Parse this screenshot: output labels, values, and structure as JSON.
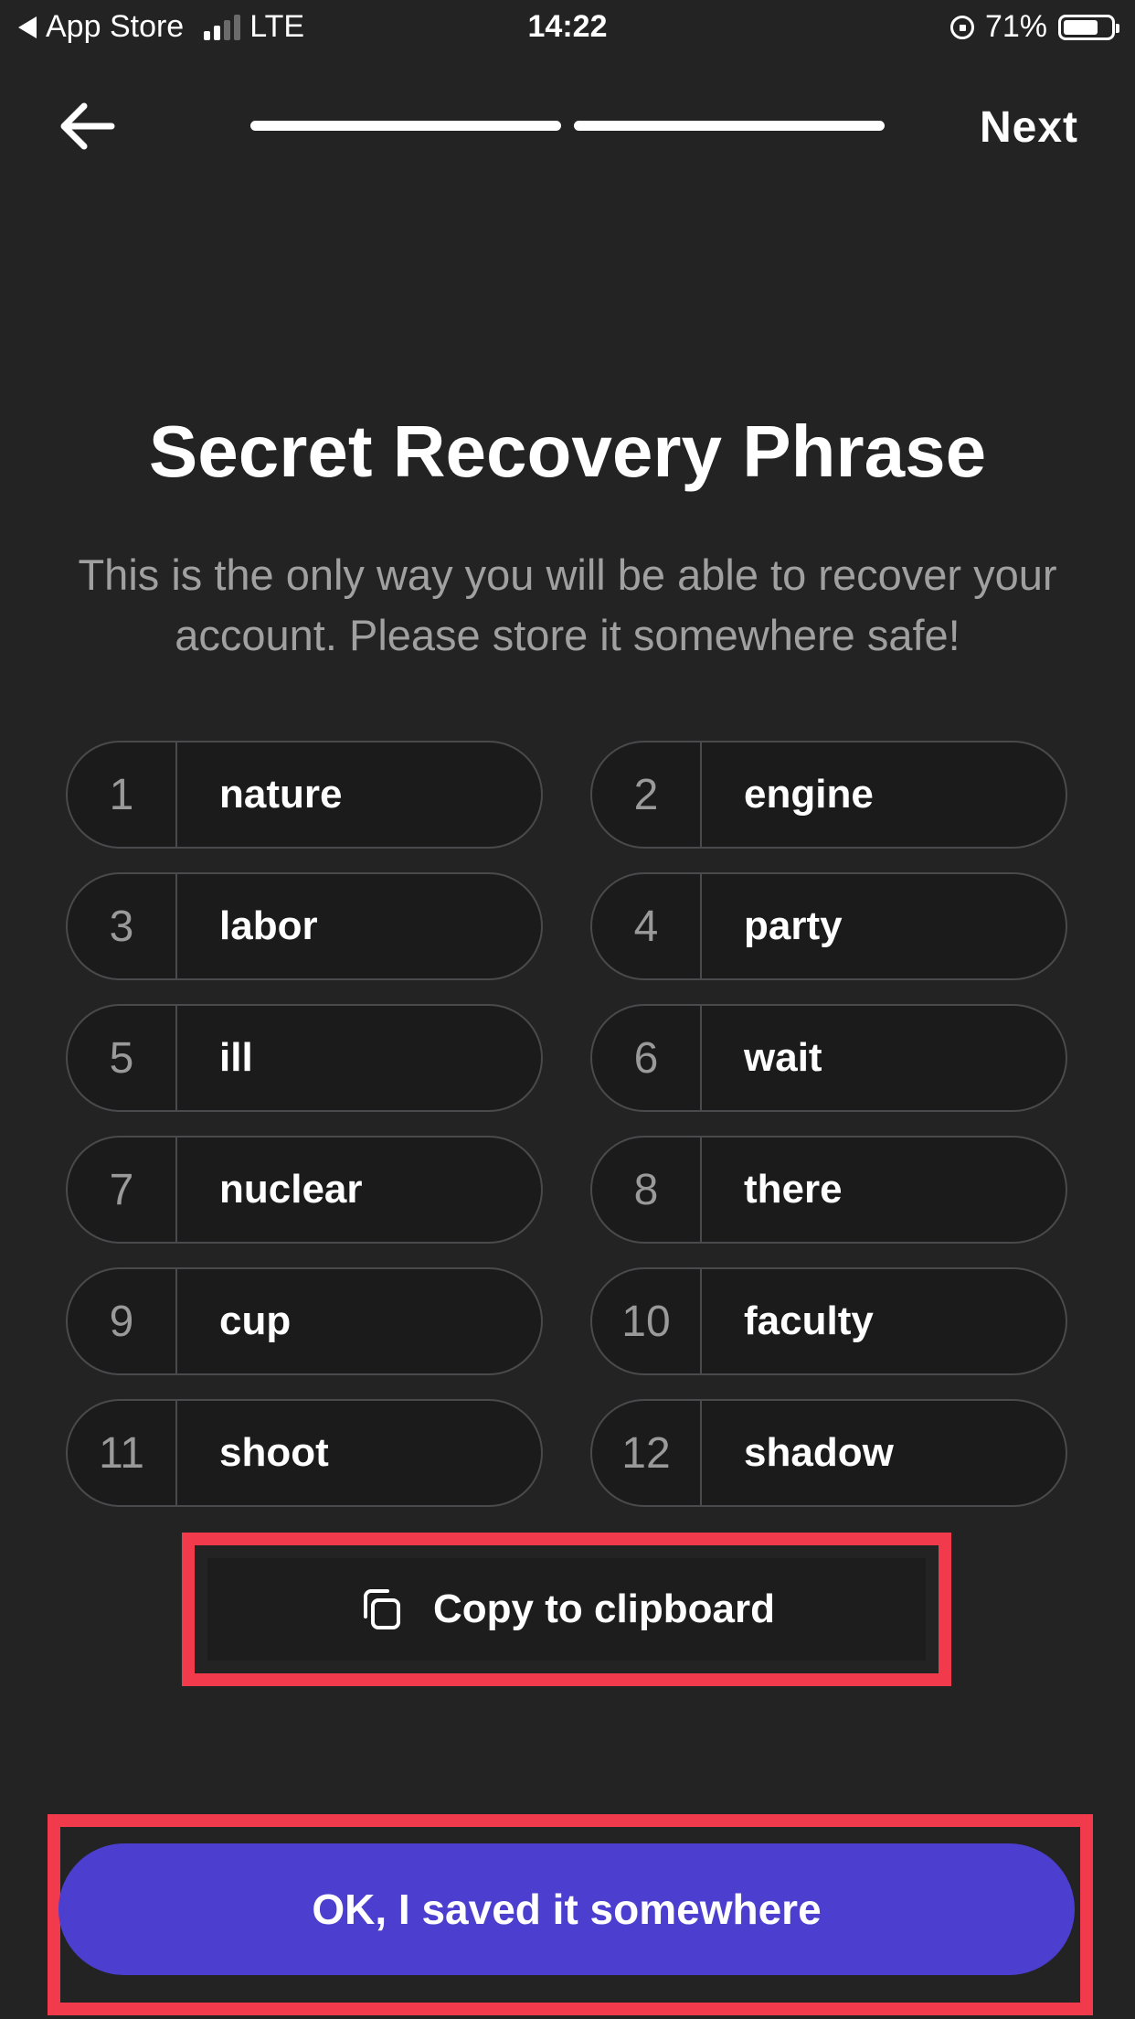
{
  "status_bar": {
    "back_app_label": "App Store",
    "network": "LTE",
    "time": "14:22",
    "battery_percent": "71%",
    "battery_level": 0.71
  },
  "nav": {
    "next_label": "Next",
    "progress_segments": 2
  },
  "title": "Secret Recovery Phrase",
  "subtitle": "This is the only way you will be able to recover your account. Please store it somewhere safe!",
  "phrase": [
    {
      "num": "1",
      "word": "nature"
    },
    {
      "num": "2",
      "word": "engine"
    },
    {
      "num": "3",
      "word": "labor"
    },
    {
      "num": "4",
      "word": "party"
    },
    {
      "num": "5",
      "word": "ill"
    },
    {
      "num": "6",
      "word": "wait"
    },
    {
      "num": "7",
      "word": "nuclear"
    },
    {
      "num": "8",
      "word": "there"
    },
    {
      "num": "9",
      "word": "cup"
    },
    {
      "num": "10",
      "word": "faculty"
    },
    {
      "num": "11",
      "word": "shoot"
    },
    {
      "num": "12",
      "word": "shadow"
    }
  ],
  "copy_label": "Copy to clipboard",
  "ok_label": "OK, I saved it somewhere",
  "colors": {
    "background": "#232324",
    "primary_button": "#4c3fcf",
    "highlight_border": "#f23a4d"
  }
}
